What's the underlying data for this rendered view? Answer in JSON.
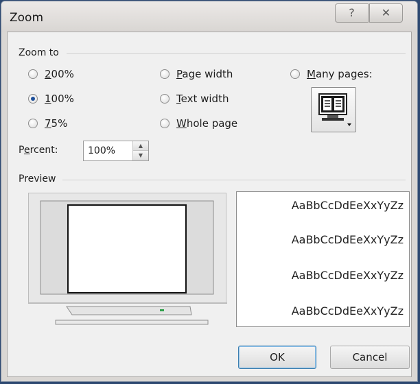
{
  "window": {
    "title": "Zoom",
    "help_glyph": "?",
    "close_glyph": "✕"
  },
  "zoom_to": {
    "label": "Zoom to",
    "options": [
      {
        "text": "200%",
        "mnemonic": "2",
        "rest": "00%",
        "checked": false
      },
      {
        "text": "100%",
        "mnemonic": "1",
        "rest": "00%",
        "checked": true
      },
      {
        "text": "75%",
        "mnemonic": "7",
        "rest": "5%",
        "checked": false
      },
      {
        "text": "Page width",
        "mnemonic": "P",
        "rest": "age width",
        "checked": false
      },
      {
        "text": "Text width",
        "mnemonic": "T",
        "rest": "ext width",
        "checked": false
      },
      {
        "text": "Whole page",
        "mnemonic": "W",
        "rest": "hole page",
        "checked": false
      },
      {
        "text": "Many pages:",
        "mnemonic": "M",
        "rest": "any pages:",
        "checked": false
      }
    ],
    "many_pages_icon": "monitor-pages-icon"
  },
  "percent": {
    "label_pre": "P",
    "label_mnemonic": "e",
    "label_post": "rcent:",
    "value": "100%"
  },
  "preview": {
    "label": "Preview",
    "sample_text": [
      "AaBbCcDdEeXxYyZz",
      "AaBbCcDdEeXxYyZz",
      "AaBbCcDdEeXxYyZz",
      "AaBbCcDdEeXxYyZz"
    ]
  },
  "buttons": {
    "ok": "OK",
    "cancel": "Cancel"
  },
  "colors": {
    "accent": "#3c7fb1",
    "radio_checked": "#1d4f9a"
  }
}
